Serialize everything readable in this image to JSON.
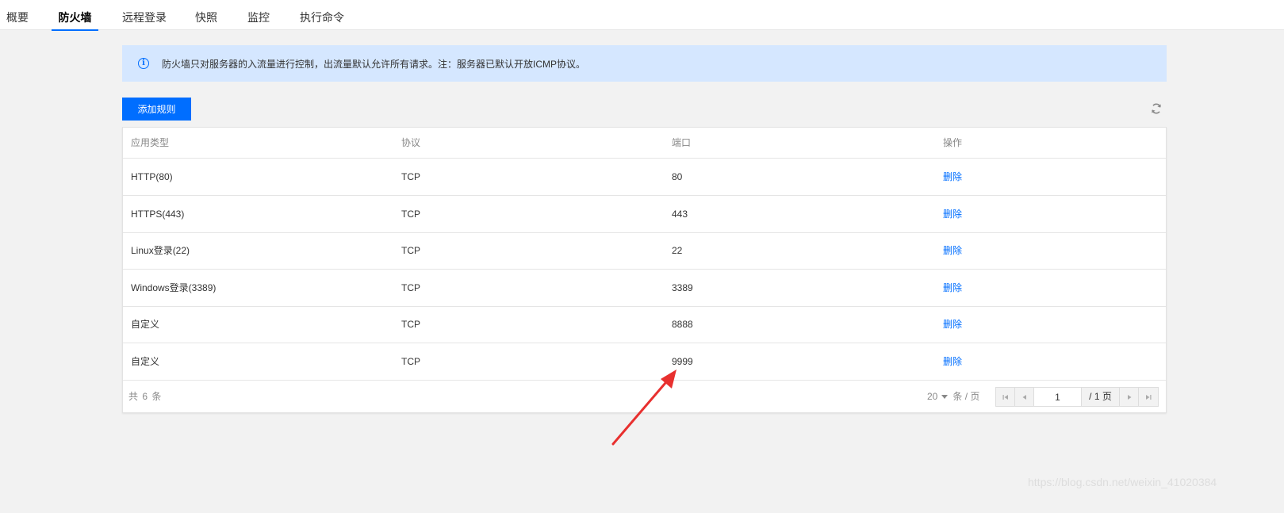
{
  "tabs": [
    {
      "label": "概要",
      "active": false
    },
    {
      "label": "防火墙",
      "active": true
    },
    {
      "label": "远程登录",
      "active": false
    },
    {
      "label": "快照",
      "active": false
    },
    {
      "label": "监控",
      "active": false
    },
    {
      "label": "执行命令",
      "active": false
    }
  ],
  "notice": {
    "icon": "info-icon",
    "text": "防火墙只对服务器的入流量进行控制，出流量默认允许所有请求。注：服务器已默认开放ICMP协议。"
  },
  "toolbar": {
    "add_label": "添加规则",
    "refresh_icon": "refresh-icon"
  },
  "table": {
    "headers": [
      "应用类型",
      "协议",
      "端口",
      "操作"
    ],
    "rows": [
      {
        "app": "HTTP(80)",
        "protocol": "TCP",
        "port": "80",
        "action": "删除"
      },
      {
        "app": "HTTPS(443)",
        "protocol": "TCP",
        "port": "443",
        "action": "删除"
      },
      {
        "app": "Linux登录(22)",
        "protocol": "TCP",
        "port": "22",
        "action": "删除"
      },
      {
        "app": "Windows登录(3389)",
        "protocol": "TCP",
        "port": "3389",
        "action": "删除"
      },
      {
        "app": "自定义",
        "protocol": "TCP",
        "port": "8888",
        "action": "删除"
      },
      {
        "app": "自定义",
        "protocol": "TCP",
        "port": "9999",
        "action": "删除"
      }
    ]
  },
  "pagination": {
    "total_text": "共 6 条",
    "page_size": "20",
    "page_size_unit": "条 / 页",
    "current_page": "1",
    "total_pages_text": "/ 1 页"
  },
  "colors": {
    "accent": "#006eff",
    "notice_bg": "#d5e7ff",
    "annotation_arrow": "#e8302f"
  },
  "watermark": "https://blog.csdn.net/weixin_41020384"
}
